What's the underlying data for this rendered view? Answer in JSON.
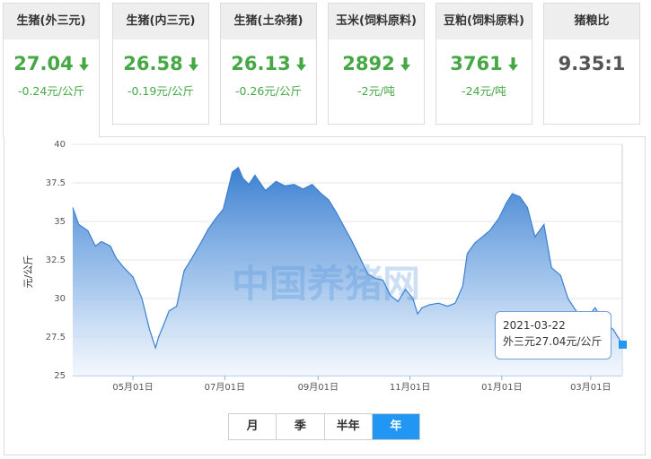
{
  "price_cards": [
    {
      "title": "生猪(外三元)",
      "price": "27.04",
      "change": "-0.24元/公斤",
      "trend": "down"
    },
    {
      "title": "生猪(内三元)",
      "price": "26.58",
      "change": "-0.19元/公斤",
      "trend": "down"
    },
    {
      "title": "生猪(土杂猪)",
      "price": "26.13",
      "change": "-0.26元/公斤",
      "trend": "down"
    },
    {
      "title": "玉米(饲料原料)",
      "price": "2892",
      "change": "-2元/吨",
      "trend": "down"
    },
    {
      "title": "豆粕(饲料原料)",
      "price": "3761",
      "change": "-24元/吨",
      "trend": "down"
    },
    {
      "title": "猪粮比",
      "price": "9.35:1",
      "change": "",
      "trend": "none"
    }
  ],
  "colors": {
    "down": "#45a845",
    "line": "#3a7fd0",
    "accent": "#2196f3",
    "card_header_bg": "#eeeeee"
  },
  "icons": {
    "trend_down": "arrow-down-icon"
  },
  "tooltip": {
    "date": "2021-03-22",
    "text": "外三元27.04元/公斤"
  },
  "watermark": "中国养猪网",
  "range_tabs": [
    {
      "label": "月",
      "selected": false
    },
    {
      "label": "季",
      "selected": false
    },
    {
      "label": "半年",
      "selected": false
    },
    {
      "label": "年",
      "selected": true
    }
  ],
  "chart_data": {
    "type": "area",
    "title": "",
    "xlabel": "",
    "ylabel": "元/公斤",
    "ylim": [
      25,
      40
    ],
    "yticks": [
      25,
      27.5,
      30,
      32.5,
      35,
      37.5,
      40
    ],
    "xlim": [
      "2020-03-22",
      "2021-03-22"
    ],
    "xticks": [
      {
        "date": "2020-05-01",
        "label": "05月01日"
      },
      {
        "date": "2020-07-01",
        "label": "07月01日"
      },
      {
        "date": "2020-09-01",
        "label": "09月01日"
      },
      {
        "date": "2020-11-01",
        "label": "11月01日"
      },
      {
        "date": "2021-01-01",
        "label": "01月01日"
      },
      {
        "date": "2021-03-01",
        "label": "03月01日"
      }
    ],
    "grid": true,
    "series": [
      {
        "name": "外三元",
        "x": [
          "2020-03-22",
          "2020-03-26",
          "2020-04-01",
          "2020-04-06",
          "2020-04-10",
          "2020-04-16",
          "2020-04-20",
          "2020-04-25",
          "2020-05-01",
          "2020-05-07",
          "2020-05-12",
          "2020-05-16",
          "2020-05-18",
          "2020-05-21",
          "2020-05-25",
          "2020-05-30",
          "2020-06-04",
          "2020-06-09",
          "2020-06-15",
          "2020-06-20",
          "2020-06-25",
          "2020-06-30",
          "2020-07-06",
          "2020-07-10",
          "2020-07-13",
          "2020-07-17",
          "2020-07-21",
          "2020-07-28",
          "2020-08-04",
          "2020-08-10",
          "2020-08-16",
          "2020-08-22",
          "2020-08-28",
          "2020-09-03",
          "2020-09-08",
          "2020-09-13",
          "2020-09-18",
          "2020-09-23",
          "2020-09-28",
          "2020-10-04",
          "2020-10-09",
          "2020-10-14",
          "2020-10-19",
          "2020-10-24",
          "2020-10-29",
          "2020-11-03",
          "2020-11-06",
          "2020-11-09",
          "2020-11-14",
          "2020-11-20",
          "2020-11-26",
          "2020-12-01",
          "2020-12-06",
          "2020-12-09",
          "2020-12-14",
          "2020-12-19",
          "2020-12-24",
          "2020-12-30",
          "2021-01-04",
          "2021-01-08",
          "2021-01-13",
          "2021-01-18",
          "2021-01-23",
          "2021-01-29",
          "2021-02-03",
          "2021-02-09",
          "2021-02-14",
          "2021-02-20",
          "2021-02-26",
          "2021-03-04",
          "2021-03-10",
          "2021-03-16",
          "2021-03-22"
        ],
        "values": [
          35.9,
          34.8,
          34.4,
          33.4,
          33.7,
          33.4,
          32.6,
          32.0,
          31.4,
          30.0,
          28.0,
          26.8,
          27.5,
          28.2,
          29.2,
          29.5,
          31.8,
          32.6,
          33.6,
          34.5,
          35.2,
          35.8,
          38.2,
          38.5,
          37.8,
          37.4,
          38.0,
          37.0,
          37.6,
          37.3,
          37.4,
          37.1,
          37.4,
          36.8,
          36.4,
          35.6,
          34.7,
          33.8,
          32.8,
          31.6,
          31.3,
          31.2,
          30.2,
          29.8,
          30.6,
          30.0,
          29.0,
          29.4,
          29.6,
          29.7,
          29.5,
          29.7,
          30.8,
          32.9,
          33.6,
          34.0,
          34.4,
          35.2,
          36.2,
          36.8,
          36.6,
          35.9,
          34.0,
          34.8,
          32.0,
          31.5,
          30.0,
          29.1,
          28.7,
          29.4,
          28.4,
          28.0,
          27.04
        ]
      }
    ]
  }
}
